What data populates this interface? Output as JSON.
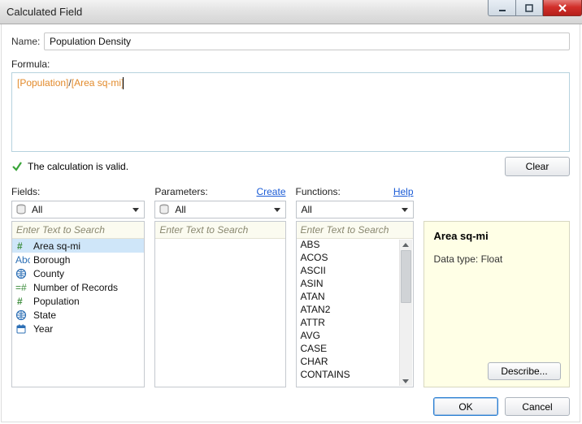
{
  "window": {
    "title": "Calculated Field"
  },
  "name_label": "Name:",
  "name_value": "Population Density",
  "formula_label": "Formula:",
  "formula": {
    "field1": "[Population]",
    "op": "/",
    "field2": "[Area sq-mi]"
  },
  "status_text": "The calculation is valid.",
  "clear_label": "Clear",
  "panels": {
    "fields": {
      "label": "Fields:",
      "combo": "All",
      "search_placeholder": "Enter Text to Search",
      "items": [
        {
          "icon": "hash",
          "text": "Area sq-mi",
          "selected": true
        },
        {
          "icon": "abc",
          "text": "Borough"
        },
        {
          "icon": "globe",
          "text": "County"
        },
        {
          "icon": "eqhash",
          "text": "Number of Records"
        },
        {
          "icon": "hash",
          "text": "Population"
        },
        {
          "icon": "globe",
          "text": "State"
        },
        {
          "icon": "cal",
          "text": "Year"
        }
      ]
    },
    "parameters": {
      "label": "Parameters:",
      "create_link": "Create",
      "combo": "All",
      "search_placeholder": "Enter Text to Search"
    },
    "functions": {
      "label": "Functions:",
      "help_link": "Help",
      "combo": "All",
      "search_placeholder": "Enter Text to Search",
      "items": [
        "ABS",
        "ACOS",
        "ASCII",
        "ASIN",
        "ATAN",
        "ATAN2",
        "ATTR",
        "AVG",
        "CASE",
        "CHAR",
        "CONTAINS"
      ]
    },
    "info": {
      "heading": "Area sq-mi",
      "subtext": "Data type: Float",
      "describe_label": "Describe..."
    }
  },
  "buttons": {
    "ok": "OK",
    "cancel": "Cancel"
  }
}
